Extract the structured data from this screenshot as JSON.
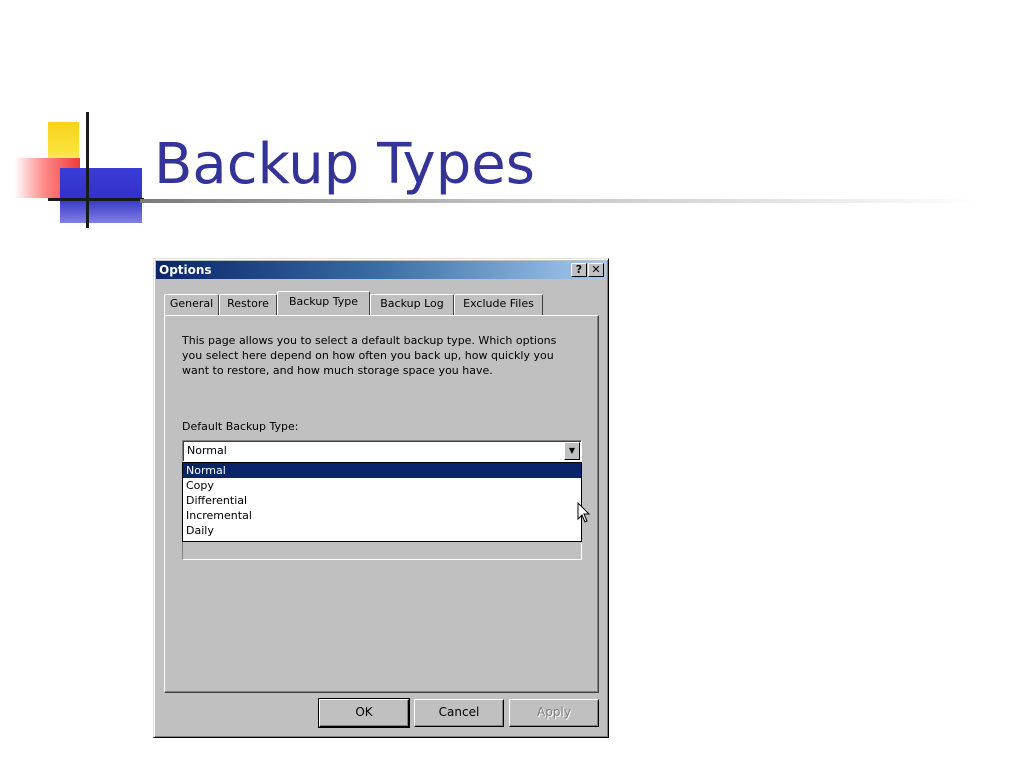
{
  "slide": {
    "title": "Backup Types"
  },
  "dialog": {
    "title": "Options",
    "help_button": "?",
    "close_button": "✕",
    "tabs": [
      {
        "label": "General"
      },
      {
        "label": "Restore"
      },
      {
        "label": "Backup Type"
      },
      {
        "label": "Backup Log"
      },
      {
        "label": "Exclude Files"
      }
    ],
    "active_tab": "Backup Type",
    "description_lines": [
      "This page allows you to select a default backup type. Which options",
      "you select here depend on how often you back up, how quickly you",
      "want to restore, and how much storage space you have."
    ],
    "default_backup_type": {
      "label": "Default Backup Type:",
      "value": "Normal",
      "options": [
        "Normal",
        "Copy",
        "Differential",
        "Incremental",
        "Daily"
      ],
      "highlighted": "Normal"
    },
    "buttons": {
      "ok": "OK",
      "cancel": "Cancel",
      "apply": "Apply"
    }
  },
  "colors": {
    "title": "#333399",
    "titlebar_start": "#0a246a",
    "titlebar_end": "#a6caf0",
    "dialog_face": "#c0c0c0",
    "selection": "#0a246a"
  }
}
